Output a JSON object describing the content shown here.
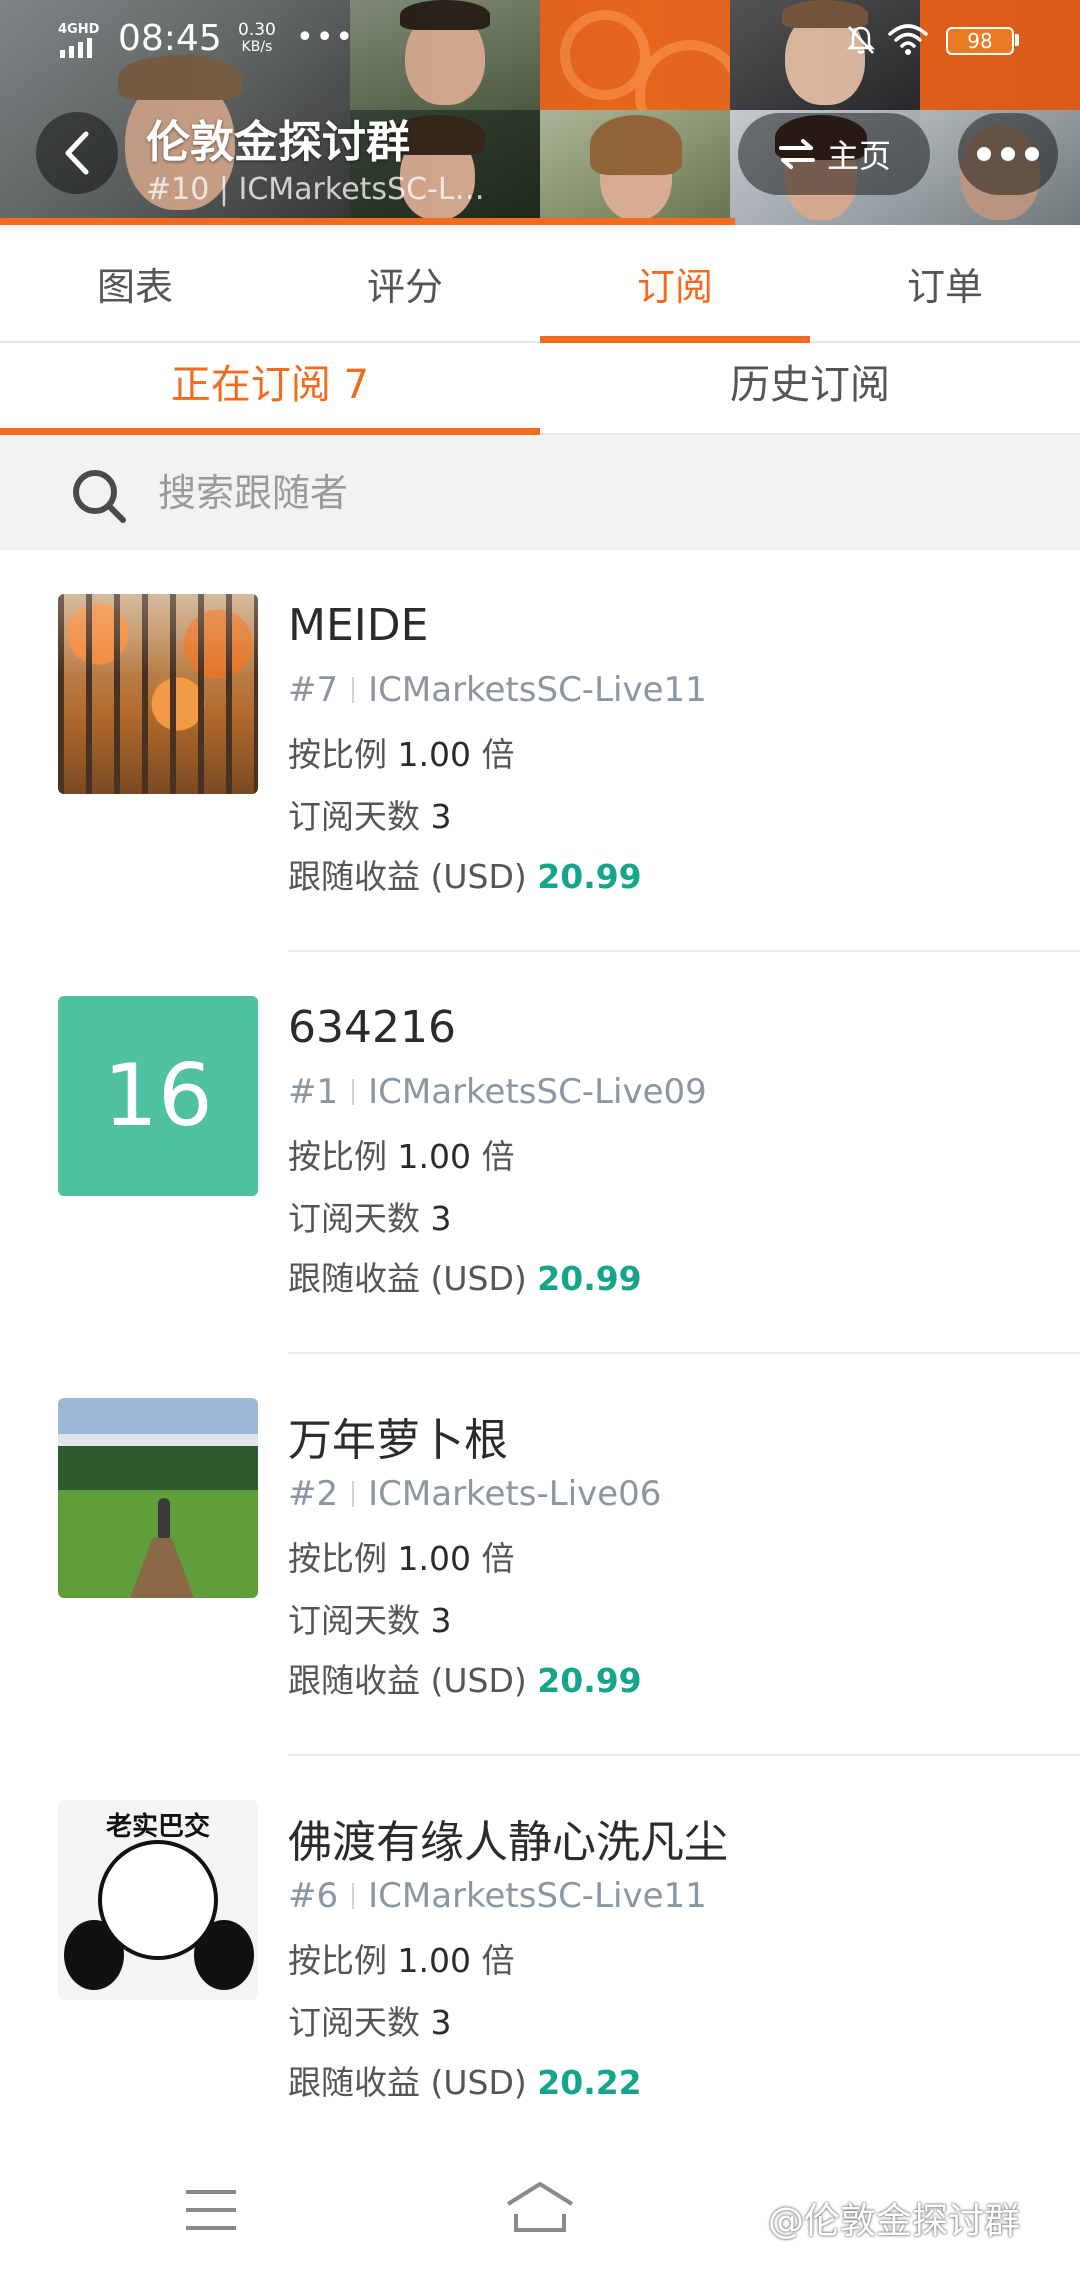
{
  "status_bar": {
    "network": "4GHD",
    "time": "08:45",
    "net_speed_value": "0.30",
    "net_speed_unit": "KB/s",
    "more_indicator": "•••",
    "battery": "98"
  },
  "header": {
    "title": "伦敦金探讨群",
    "subtitle": "#10 | ICMarketsSC-L…",
    "home_label": "主页"
  },
  "tabs": [
    {
      "label": "图表",
      "active": false
    },
    {
      "label": "评分",
      "active": false
    },
    {
      "label": "订阅",
      "active": true
    },
    {
      "label": "订单",
      "active": false
    }
  ],
  "subtabs": [
    {
      "label": "正在订阅 7",
      "active": true
    },
    {
      "label": "历史订阅",
      "active": false
    }
  ],
  "search": {
    "placeholder": "搜索跟随者",
    "value": ""
  },
  "labels": {
    "ratio_prefix": "按比例",
    "ratio_suffix": "倍",
    "days_label": "订阅天数",
    "profit_label": "跟随收益 (USD)"
  },
  "subscribers": [
    {
      "name": "MEIDE",
      "rank": "#7",
      "server": "ICMarketsSC-Live11",
      "ratio": "1.00",
      "days": "3",
      "profit": "20.99",
      "avatar": "autumn-forest-photo"
    },
    {
      "name": "634216",
      "rank": "#1",
      "server": "ICMarketsSC-Live09",
      "ratio": "1.00",
      "days": "3",
      "profit": "20.99",
      "avatar_text": "16",
      "avatar": "number-tile"
    },
    {
      "name": "万年萝卜根",
      "rank": "#2",
      "server": "ICMarkets-Live06",
      "ratio": "1.00",
      "days": "3",
      "profit": "20.99",
      "avatar": "meadow-photo"
    },
    {
      "name": "佛渡有缘人静心洗凡尘",
      "rank": "#6",
      "server": "ICMarketsSC-Live11",
      "ratio": "1.00",
      "days": "3",
      "profit": "20.22",
      "avatar_text": "老实巴交",
      "avatar": "panda-meme"
    }
  ],
  "watermark": "@伦敦金探讨群",
  "colors": {
    "accent": "#f26b1e",
    "profit": "#14a58b",
    "tile": "#4fc0a0"
  }
}
